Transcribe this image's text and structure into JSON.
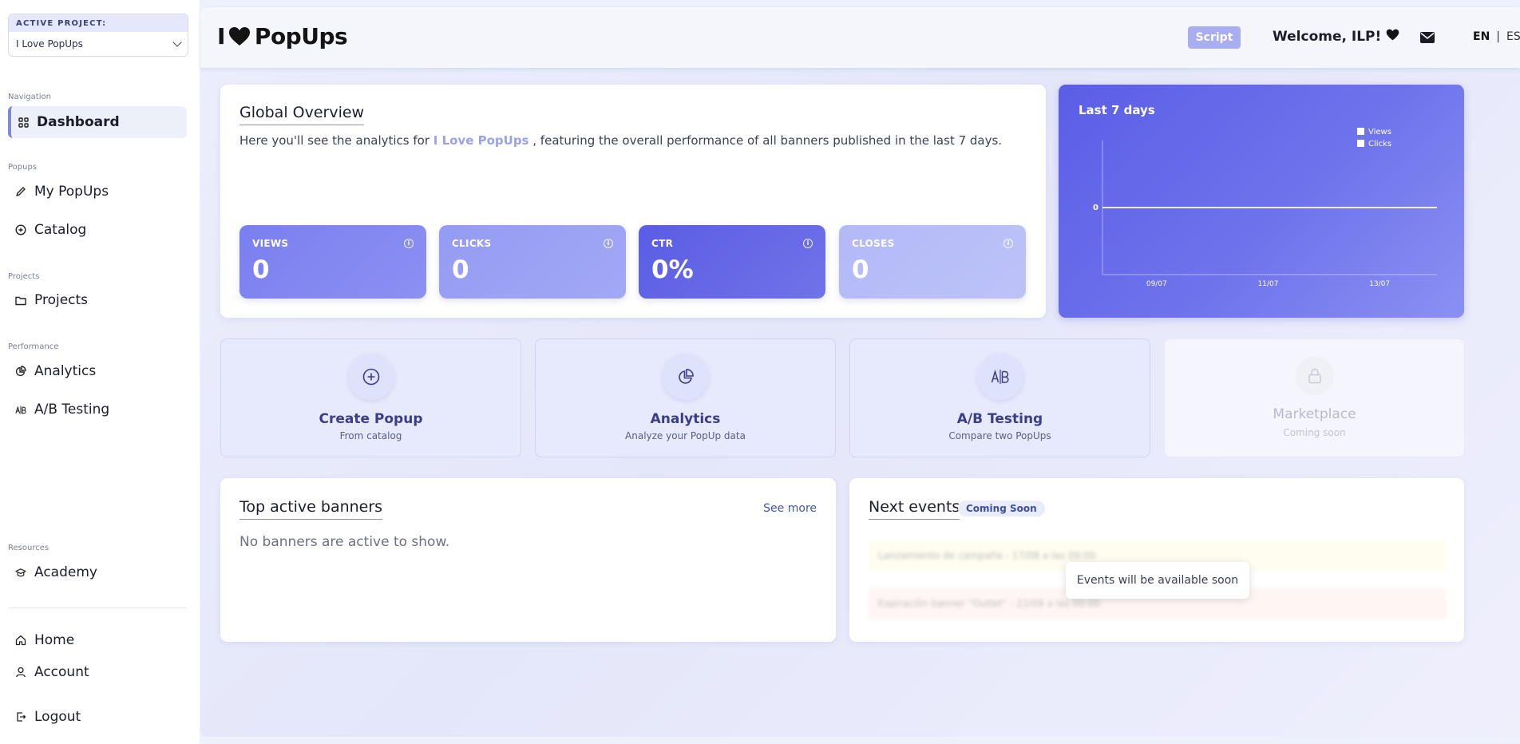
{
  "sidebar": {
    "project_label": "ACTIVE PROJECT:",
    "project_value": "I Love PopUps",
    "sections": {
      "navigation": "Navigation",
      "popups": "Popups",
      "projects": "Projects",
      "performance": "Performance",
      "resources": "Resources"
    },
    "items": {
      "dashboard": "Dashboard",
      "my_popups": "My PopUps",
      "catalog": "Catalog",
      "projects": "Projects",
      "analytics": "Analytics",
      "ab_testing": "A/B Testing",
      "academy": "Academy",
      "home": "Home",
      "account": "Account",
      "logout": "Logout"
    }
  },
  "header": {
    "logo_left": "I",
    "logo_right": "PopUps",
    "script_label": "Script",
    "welcome": "Welcome, ILP!",
    "lang_en": "EN",
    "lang_sep": "|",
    "lang_es": "ES"
  },
  "overview": {
    "title": "Global Overview",
    "text_before": "Here you'll see the analytics for ",
    "project_name": "I Love PopUps",
    "text_after": " , featuring the overall performance of all banners published in the last 7 days.",
    "stats": [
      {
        "label": "VIEWS",
        "value": "0",
        "color": "#7a7ff0"
      },
      {
        "label": "CLICKS",
        "value": "0",
        "color": "#949bf3"
      },
      {
        "label": "CTR",
        "value": "0%",
        "color": "#5a5de4"
      },
      {
        "label": "CLOSES",
        "value": "0",
        "color": "#b3b9f7"
      }
    ]
  },
  "chart": {
    "title": "Last 7 days"
  },
  "chart_data": {
    "type": "line",
    "title": "Last 7 days",
    "x_ticks": [
      "09/07",
      "11/07",
      "13/07"
    ],
    "y_ticks": [
      "0"
    ],
    "series": [
      {
        "name": "Views",
        "values": [
          0,
          0,
          0,
          0,
          0,
          0,
          0
        ]
      },
      {
        "name": "Clicks",
        "values": [
          0,
          0,
          0,
          0,
          0,
          0,
          0
        ]
      }
    ],
    "legend_position": "top-right",
    "colors": {
      "line": "#ffffff",
      "background": "#6367e8"
    }
  },
  "actions": [
    {
      "title": "Create Popup",
      "subtitle": "From catalog",
      "icon": "plus-circle-icon"
    },
    {
      "title": "Analytics",
      "subtitle": "Analyze your PopUp data",
      "icon": "pie-chart-icon"
    },
    {
      "title": "A/B Testing",
      "subtitle": "Compare two PopUps",
      "icon": "ab-icon"
    },
    {
      "title": "Marketplace",
      "subtitle": "Coming soon",
      "icon": "lock-icon"
    }
  ],
  "banners": {
    "title": "Top active banners",
    "see_more": "See more",
    "empty": "No banners are active to show."
  },
  "events": {
    "title": "Next events",
    "badge": "Coming Soon",
    "blurred_rows": [
      "Lanzamiento de campaña - 17/08 a las 09:00",
      "Expiración banner \"Outlet\" - 22/08 a las 00:00"
    ],
    "tooltip": "Events will be available soon"
  },
  "colors": {
    "accent": "#5a5de4",
    "link": "#3e54b5",
    "highlight": "#9aa2ec"
  }
}
